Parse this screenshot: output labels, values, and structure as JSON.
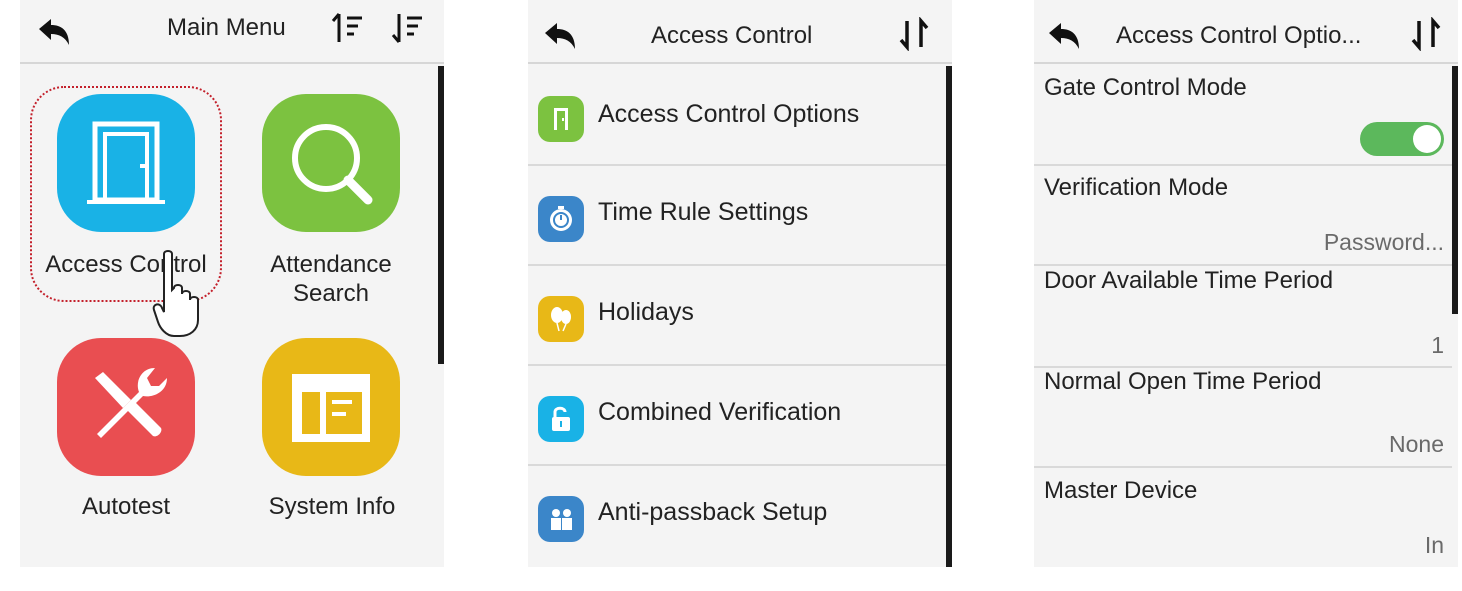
{
  "main_menu": {
    "title": "Main Menu",
    "items": [
      {
        "label": "Access Control",
        "icon": "door-icon",
        "color": "#19b2e6"
      },
      {
        "label": "Attendance Search",
        "icon": "magnifier-icon",
        "color": "#7cc240"
      },
      {
        "label": "Autotest",
        "icon": "wrench-screwdriver-icon",
        "color": "#e94e51"
      },
      {
        "label": "System Info",
        "icon": "info-panel-icon",
        "color": "#e8b817"
      }
    ]
  },
  "access_control": {
    "title": "Access Control",
    "items": [
      {
        "label": "Access Control Options",
        "icon": "door-icon",
        "color": "#7cc240"
      },
      {
        "label": "Time Rule Settings",
        "icon": "stopwatch-icon",
        "color": "#3b86c9"
      },
      {
        "label": "Holidays",
        "icon": "balloons-icon",
        "color": "#e8b817"
      },
      {
        "label": "Combined Verification",
        "icon": "unlock-icon",
        "color": "#19b2e6"
      },
      {
        "label": "Anti-passback Setup",
        "icon": "people-icon",
        "color": "#3b86c9"
      }
    ]
  },
  "options": {
    "title": "Access Control Optio...",
    "items": [
      {
        "label": "Gate Control Mode",
        "value": "",
        "toggle": true
      },
      {
        "label": "Verification Mode",
        "value": "Password..."
      },
      {
        "label": "Door Available Time Period",
        "value": "1"
      },
      {
        "label": "Normal Open Time Period",
        "value": "None"
      },
      {
        "label": "Master Device",
        "value": "In"
      }
    ]
  },
  "colors": {
    "toggle_on": "#5cb85c",
    "highlight": "#c3202b"
  }
}
